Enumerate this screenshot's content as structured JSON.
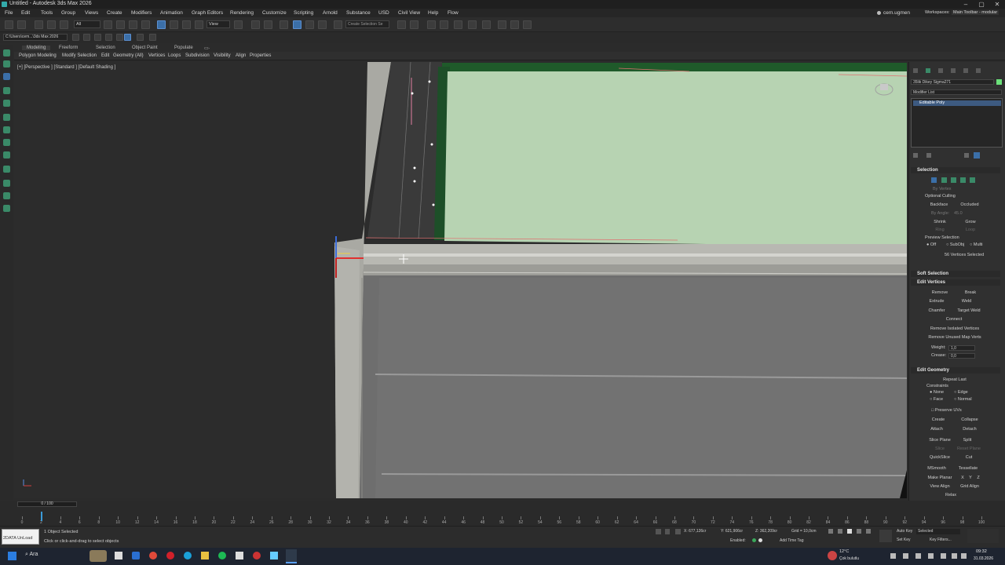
{
  "window": {
    "title": "Untitled - Autodesk 3ds Max 2026",
    "controls": [
      "minimize-icon",
      "maximize-icon",
      "close-icon"
    ]
  },
  "menu": {
    "items": [
      "File",
      "Edit",
      "Tools",
      "Group",
      "Views",
      "Create",
      "Modifiers",
      "Animation",
      "Graph Editors",
      "Rendering",
      "Customize",
      "Scripting",
      "Arnold",
      "Substance",
      "USD",
      "Civil View",
      "Help",
      "Flow"
    ],
    "user": "cem.ugmen",
    "workspaces_label": "Workspaces:",
    "workspace_value": "Main Toolbar - modular"
  },
  "toolbar": {
    "selection_filter": "All",
    "ref_coord": "View",
    "selection_set": "Create Selection Se",
    "project_path": "C:\\Users\\cem...\\3ds Max 2026"
  },
  "ribbon": {
    "tabs": [
      "Modeling",
      "Freeform",
      "Selection",
      "Object Paint",
      "Populate"
    ],
    "active_tab": "Modeling",
    "items": [
      "Polygon Modeling",
      "Modify Selection",
      "Edit",
      "Geometry (All)",
      "Vertices",
      "Loops",
      "Subdivision",
      "Visibility",
      "Align",
      "Properties"
    ]
  },
  "viewport": {
    "label": "[+] [Perspective ] [Standard ] [Default Shading ]"
  },
  "command_panel": {
    "object_name": "35lik Dikey Sigma271",
    "modifier_list_label": "Modifier List",
    "stack_item": "Editable Poly",
    "selection": {
      "title": "Selection",
      "by_vertex": "By Vertex",
      "ignore_backfacing": "Optional Culling",
      "backface": "Backface",
      "occluded": "Occluded",
      "by_angle": "By Angle:",
      "angle_value": "45.0",
      "shrink": "Shrink",
      "grow": "Grow",
      "ring": "Ring",
      "loop": "Loop",
      "preview_selection": "Preview Selection",
      "preview_options": [
        "Off",
        "SubObj",
        "Multi"
      ],
      "status": "56 Vertices Selected"
    },
    "soft_selection": {
      "title": "Soft Selection"
    },
    "edit_vertices": {
      "title": "Edit Vertices",
      "buttons": [
        "Remove",
        "Break",
        "Extrude",
        "Weld",
        "Chamfer",
        "Target Weld",
        "Connect",
        "Remove Isolated Vertices",
        "Remove Unused Map Verts"
      ],
      "weight_label": "Weight:",
      "weight_value": "1,0",
      "crease_label": "Crease:",
      "crease_value": "0,0"
    },
    "edit_geometry": {
      "title": "Edit Geometry",
      "repeat_last": "Repeat Last",
      "constraints_label": "Constraints",
      "constraints": [
        "None",
        "Edge",
        "Face",
        "Normal"
      ],
      "preserve_uvs": "Preserve UVs",
      "buttons": [
        "Create",
        "Collapse",
        "Attach",
        "Detach",
        "Slice Plane",
        "Split",
        "Slice",
        "Reset Plane",
        "QuickSlice",
        "Cut",
        "MSmooth",
        "Tessellate",
        "Make Planar",
        "X",
        "Y",
        "Z",
        "View Align",
        "Grid Align",
        "Relax"
      ]
    }
  },
  "timeline": {
    "frame_display": "0 / 100",
    "ticks": [
      0,
      2,
      4,
      6,
      8,
      10,
      12,
      14,
      16,
      18,
      20,
      22,
      24,
      26,
      28,
      30,
      32,
      34,
      36,
      38,
      40,
      42,
      44,
      46,
      48,
      50,
      52,
      54,
      56,
      58,
      60,
      62,
      64,
      66,
      68,
      70,
      72,
      74,
      76,
      78,
      80,
      82,
      84,
      86,
      88,
      90,
      92,
      94,
      96,
      98,
      100
    ],
    "labeled_ticks": [
      0,
      2,
      4,
      6,
      8,
      10,
      12,
      14,
      16,
      18,
      20,
      22,
      24,
      26,
      28,
      30,
      32,
      34,
      36,
      38,
      40,
      42,
      44,
      46,
      48,
      50,
      52,
      54,
      56,
      58,
      60,
      62,
      64,
      66,
      68,
      70,
      72,
      74,
      76,
      78,
      80,
      82,
      84,
      86,
      88,
      90,
      92,
      94,
      96,
      98,
      100
    ]
  },
  "status": {
    "maxscript": "2DATA UnLoad",
    "selected": "1 Object Selected",
    "prompt": "Click or click-and-drag to select objects",
    "x_value": "X: 677,126cr",
    "y_value": "Y: 621,906cr",
    "z_value": "Z: 362,209cr",
    "grid": "Grid = 10,0cm",
    "enabled": "Enabled:",
    "add_time_tag": "Add Time Tag",
    "auto_key": "Auto Key",
    "set_key": "Set Key",
    "selected_dropdown": "Selected",
    "key_filters": "Key Filters..."
  },
  "taskbar": {
    "search": "Ara",
    "weather_temp": "12°C",
    "weather_text": "Çok bulutlu",
    "time": "09:32",
    "date": "31.03.2026"
  }
}
